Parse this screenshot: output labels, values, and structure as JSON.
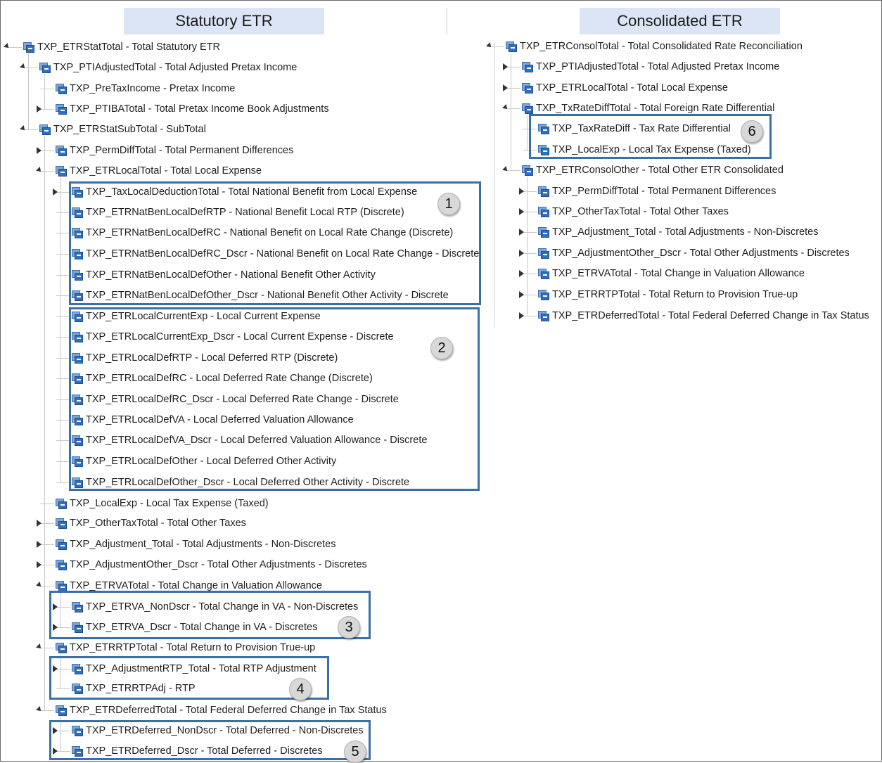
{
  "headers": {
    "left": "Statutory ETR",
    "right": "Consolidated ETR"
  },
  "icon": "hierarchy-member-icon",
  "colors": {
    "header_bg": "#dbe5f5",
    "highlight_border": "#3b6fa8",
    "badge_bg": "#d8d8d8"
  },
  "left_tree": [
    {
      "label": "TXP_ETRStatTotal - Total Statutory ETR",
      "expander": "expanded"
    },
    {
      "label": "TXP_PTIAdjustedTotal - Total Adjusted Pretax Income",
      "expander": "expanded"
    },
    {
      "label": "TXP_PreTaxIncome - Pretax Income",
      "expander": "none"
    },
    {
      "label": "TXP_PTIBATotal - Total Pretax Income Book Adjustments",
      "expander": "collapsed"
    },
    {
      "label": "TXP_ETRStatSubTotal - SubTotal",
      "expander": "expanded"
    },
    {
      "label": "TXP_PermDiffTotal - Total Permanent Differences",
      "expander": "collapsed"
    },
    {
      "label": "TXP_ETRLocalTotal - Total Local Expense",
      "expander": "expanded"
    },
    {
      "label": "TXP_TaxLocalDeductionTotal - Total National Benefit from Local Expense",
      "expander": "collapsed"
    },
    {
      "label": "TXP_ETRNatBenLocalDefRTP - National Benefit Local RTP (Discrete)",
      "expander": "none"
    },
    {
      "label": "TXP_ETRNatBenLocalDefRC - National Benefit on Local Rate Change (Discrete)",
      "expander": "none"
    },
    {
      "label": "TXP_ETRNatBenLocalDefRC_Dscr - National Benefit on Local Rate Change - Discrete",
      "expander": "none"
    },
    {
      "label": "TXP_ETRNatBenLocalDefOther - National Benefit Other Activity",
      "expander": "none"
    },
    {
      "label": "TXP_ETRNatBenLocalDefOther_Dscr - National Benefit Other Activity - Discrete",
      "expander": "none"
    },
    {
      "label": "TXP_ETRLocalCurrentExp - Local Current Expense",
      "expander": "none"
    },
    {
      "label": "TXP_ETRLocalCurrentExp_Dscr - Local Current Expense - Discrete",
      "expander": "none"
    },
    {
      "label": "TXP_ETRLocalDefRTP - Local Deferred RTP (Discrete)",
      "expander": "none"
    },
    {
      "label": "TXP_ETRLocalDefRC - Local Deferred Rate Change (Discrete)",
      "expander": "none"
    },
    {
      "label": "TXP_ETRLocalDefRC_Dscr - Local Deferred Rate Change - Discrete",
      "expander": "none"
    },
    {
      "label": "TXP_ETRLocalDefVA - Local Deferred Valuation Allowance",
      "expander": "none"
    },
    {
      "label": "TXP_ETRLocalDefVA_Dscr - Local Deferred Valuation Allowance - Discrete",
      "expander": "none"
    },
    {
      "label": "TXP_ETRLocalDefOther - Local Deferred Other Activity",
      "expander": "none"
    },
    {
      "label": "TXP_ETRLocalDefOther_Dscr - Local Deferred Other Activity - Discrete",
      "expander": "none"
    },
    {
      "label": "TXP_LocalExp - Local Tax Expense (Taxed)",
      "expander": "none"
    },
    {
      "label": "TXP_OtherTaxTotal - Total Other Taxes",
      "expander": "collapsed"
    },
    {
      "label": "TXP_Adjustment_Total - Total Adjustments - Non-Discretes",
      "expander": "collapsed"
    },
    {
      "label": "TXP_AdjustmentOther_Dscr - Total Other Adjustments - Discretes",
      "expander": "collapsed"
    },
    {
      "label": "TXP_ETRVATotal - Total Change in Valuation Allowance",
      "expander": "expanded"
    },
    {
      "label": "TXP_ETRVA_NonDscr - Total Change in VA - Non-Discretes",
      "expander": "collapsed"
    },
    {
      "label": "TXP_ETRVA_Dscr - Total Change in VA - Discretes",
      "expander": "collapsed"
    },
    {
      "label": "TXP_ETRRTPTotal - Total Return to Provision True-up",
      "expander": "expanded"
    },
    {
      "label": "TXP_AdjustmentRTP_Total - Total RTP Adjustment",
      "expander": "collapsed"
    },
    {
      "label": "TXP_ETRRTPAdj - RTP",
      "expander": "none"
    },
    {
      "label": "TXP_ETRDeferredTotal - Total Federal Deferred Change in Tax Status",
      "expander": "expanded"
    },
    {
      "label": "TXP_ETRDeferred_NonDscr - Total Deferred - Non-Discretes",
      "expander": "collapsed"
    },
    {
      "label": "TXP_ETRDeferred_Dscr - Total Deferred - Discretes",
      "expander": "collapsed"
    }
  ],
  "right_tree": [
    {
      "label": "TXP_ETRConsolTotal - Total Consolidated Rate Reconciliation",
      "expander": "expanded"
    },
    {
      "label": "TXP_PTIAdjustedTotal - Total Adjusted Pretax Income",
      "expander": "collapsed"
    },
    {
      "label": "TXP_ETRLocalTotal - Total Local Expense",
      "expander": "collapsed"
    },
    {
      "label": "TXP_TxRateDiffTotal - Total Foreign Rate Differential",
      "expander": "expanded"
    },
    {
      "label": "TXP_TaxRateDiff - Tax Rate Differential",
      "expander": "none"
    },
    {
      "label": "TXP_LocalExp - Local Tax Expense (Taxed)",
      "expander": "none"
    },
    {
      "label": "TXP_ETRConsolOther - Total Other ETR Consolidated",
      "expander": "expanded"
    },
    {
      "label": "TXP_PermDiffTotal - Total Permanent Differences",
      "expander": "collapsed"
    },
    {
      "label": "TXP_OtherTaxTotal - Total Other Taxes",
      "expander": "collapsed"
    },
    {
      "label": "TXP_Adjustment_Total - Total Adjustments - Non-Discretes",
      "expander": "collapsed"
    },
    {
      "label": "TXP_AdjustmentOther_Dscr - Total Other Adjustments - Discretes",
      "expander": "collapsed"
    },
    {
      "label": "TXP_ETRVATotal - Total Change in Valuation Allowance",
      "expander": "collapsed"
    },
    {
      "label": "TXP_ETRRTPTotal - Total Return to Provision True-up",
      "expander": "collapsed"
    },
    {
      "label": "TXP_ETRDeferredTotal - Total Federal Deferred Change in Tax Status",
      "expander": "collapsed"
    }
  ],
  "callouts": [
    "1",
    "2",
    "3",
    "4",
    "5",
    "6"
  ]
}
